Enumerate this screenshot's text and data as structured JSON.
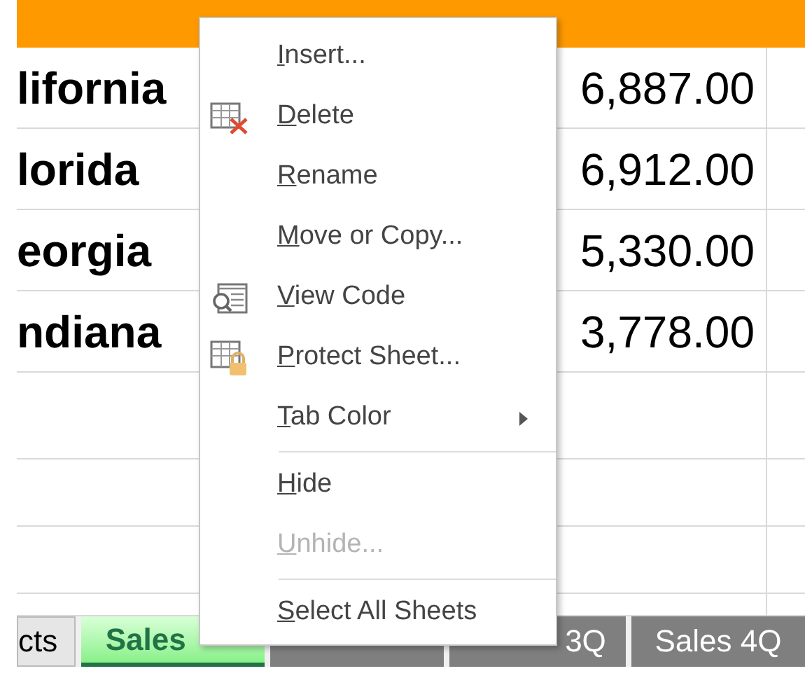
{
  "sheet": {
    "rows": [
      {
        "state": "lifornia",
        "amount": "6,887.00"
      },
      {
        "state": "lorida",
        "amount": "6,912.00"
      },
      {
        "state": "eorgia",
        "amount": "5,330.00"
      },
      {
        "state": "ndiana",
        "amount": "3,778.00"
      }
    ]
  },
  "context_menu": {
    "items": [
      {
        "kind": "item",
        "label": "Insert...",
        "disabled": false
      },
      {
        "kind": "item",
        "label": "Delete",
        "disabled": false
      },
      {
        "kind": "item",
        "label": "Rename",
        "disabled": false
      },
      {
        "kind": "item",
        "label": "Move or Copy...",
        "disabled": false
      },
      {
        "kind": "item",
        "label": "View Code",
        "disabled": false
      },
      {
        "kind": "item",
        "label": "Protect Sheet...",
        "disabled": false
      },
      {
        "kind": "item",
        "label": "Tab Color",
        "submenu": true,
        "disabled": false
      },
      {
        "kind": "separator"
      },
      {
        "kind": "item",
        "label": "Hide",
        "disabled": false
      },
      {
        "kind": "item",
        "label": "Unhide...",
        "disabled": true
      },
      {
        "kind": "separator"
      },
      {
        "kind": "item",
        "label": "Select All Sheets",
        "disabled": false
      }
    ]
  },
  "sheet_tabs": [
    {
      "label": "cts",
      "selected": false,
      "colored": false
    },
    {
      "label": "Sales",
      "selected": true,
      "colored": true
    },
    {
      "selected": false,
      "colored": false
    },
    {
      "label": "3Q",
      "selected": false,
      "colored": false
    },
    {
      "label": "Sales 4Q",
      "selected": false,
      "colored": false
    }
  ]
}
